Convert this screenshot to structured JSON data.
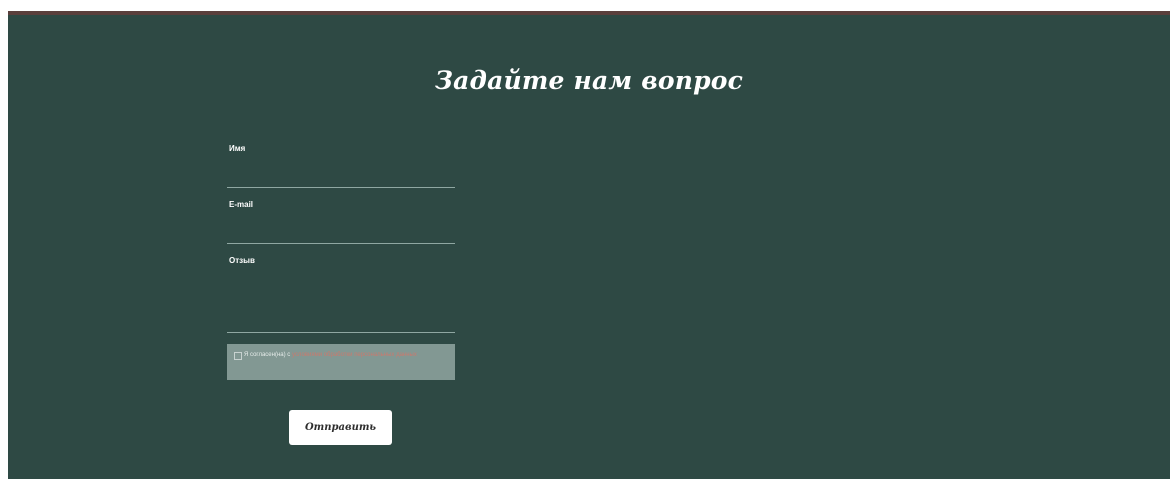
{
  "form": {
    "title": "Задайте нам вопрос",
    "fields": [
      {
        "label": "Имя"
      },
      {
        "label": "E-mail"
      },
      {
        "label": "Отзыв"
      }
    ],
    "consent": {
      "text": "Я согласен(на) с",
      "link_text": "условиями обработки персональных данных"
    },
    "submit_label": "Отправить"
  },
  "colors": {
    "background": "#2e4944",
    "top_strip": "#5a3f3c",
    "consent_box": "#829893",
    "button": "#ffffff"
  }
}
